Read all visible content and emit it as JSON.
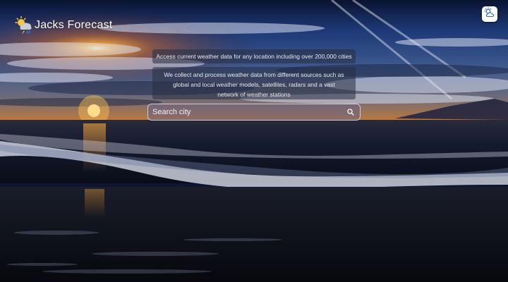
{
  "header": {
    "title": "Jacks Forecast",
    "logo_icon": "sun-cloud-rain-icon"
  },
  "toolbar": {
    "weather_button_icon": "sun-cloud-icon"
  },
  "info": {
    "line1": "Access current weather data for any location including over 200,000 cities",
    "line2": "We collect and process weather data from different sources such as global and local weather models, satellites, radars and a vast network of weather stations"
  },
  "search": {
    "placeholder": "Search city",
    "value": ""
  },
  "background": {
    "description_icon": "beach-sunset-background",
    "colors": {
      "sky_top": "#0b1636",
      "sky_mid": "#2a4a88",
      "sun": "#ffb23a",
      "sea": "#10162a",
      "sand": "#0a0c14"
    }
  }
}
